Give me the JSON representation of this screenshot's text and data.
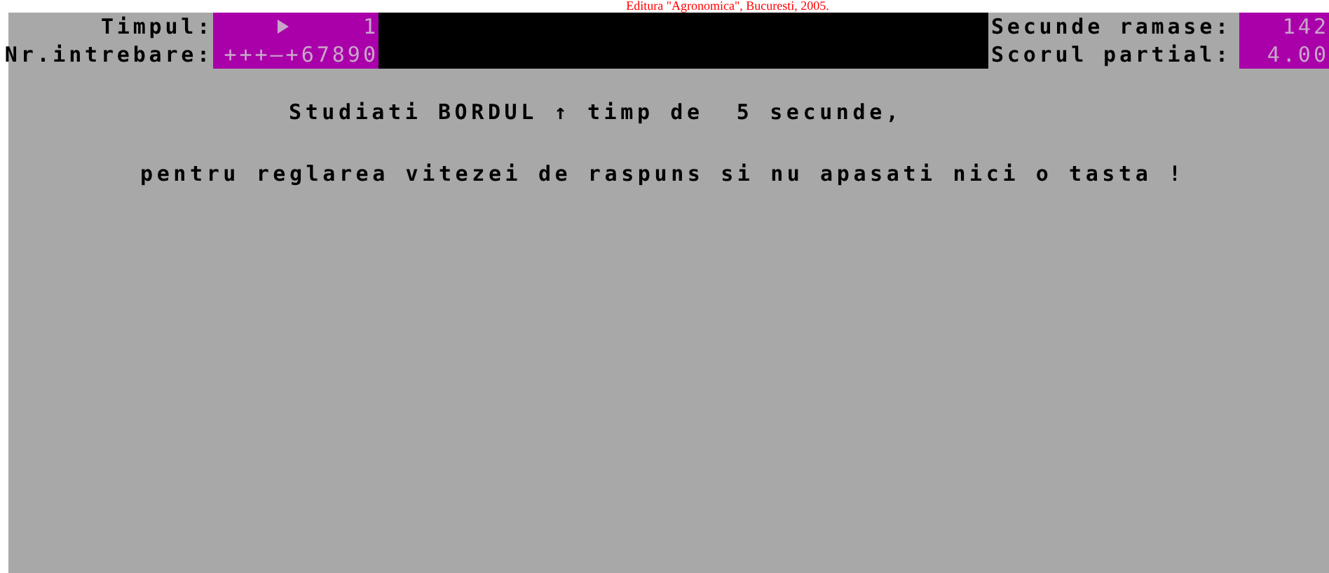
{
  "caption": "Editura \"Agronomica\", Bucuresti, 2005.",
  "left_fields": [
    {
      "label": "Timpul:",
      "value": "1",
      "kind": "pointer"
    },
    {
      "label": "Nr.intrebare:",
      "value": "+++—+67890",
      "kind": "plain"
    }
  ],
  "right_fields": [
    {
      "label": "Secunde ramase:",
      "value": "142"
    },
    {
      "label": "Scorul partial:",
      "value": "4.00"
    }
  ],
  "messages": [
    "Studiati BORDUL ↑ timp de  5 secunde,",
    "pentru reglarea vitezei de raspuns si nu apasati nici o tasta !"
  ]
}
